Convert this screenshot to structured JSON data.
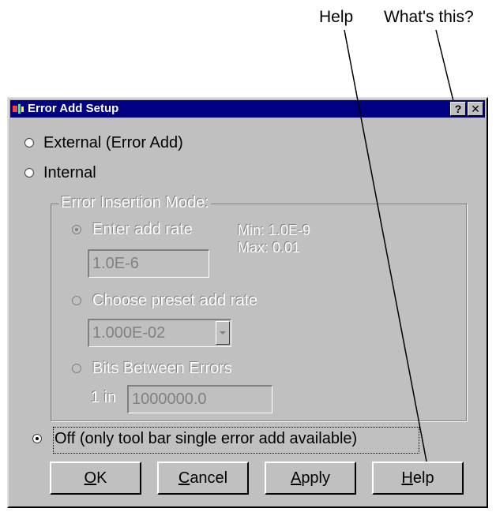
{
  "callouts": {
    "help": "Help",
    "whats_this": "What's this?"
  },
  "window": {
    "title": "Error Add Setup",
    "help_button": "?",
    "close_button": "✕"
  },
  "options": {
    "external": "External (Error Add)",
    "internal": "Internal",
    "off": "Off (only tool bar single error add available)",
    "selected": "off"
  },
  "insertion_mode": {
    "legend": "Error Insertion Mode:",
    "enter_rate_label": "Enter add rate",
    "min_text": "Min: 1.0E-9",
    "max_text": "Max: 0.01",
    "add_rate_value": "1.0E-6",
    "preset_label": "Choose preset add rate",
    "preset_value": "1.000E-02",
    "bits_label": "Bits Between Errors",
    "one_in_label": "1 in",
    "bits_value": "1000000.0"
  },
  "buttons": {
    "ok": "OK",
    "ok_mnemonic": "O",
    "cancel": "Cancel",
    "cancel_mnemonic": "C",
    "apply": "Apply",
    "apply_mnemonic": "A",
    "help": "Help",
    "help_mnemonic": "H"
  }
}
